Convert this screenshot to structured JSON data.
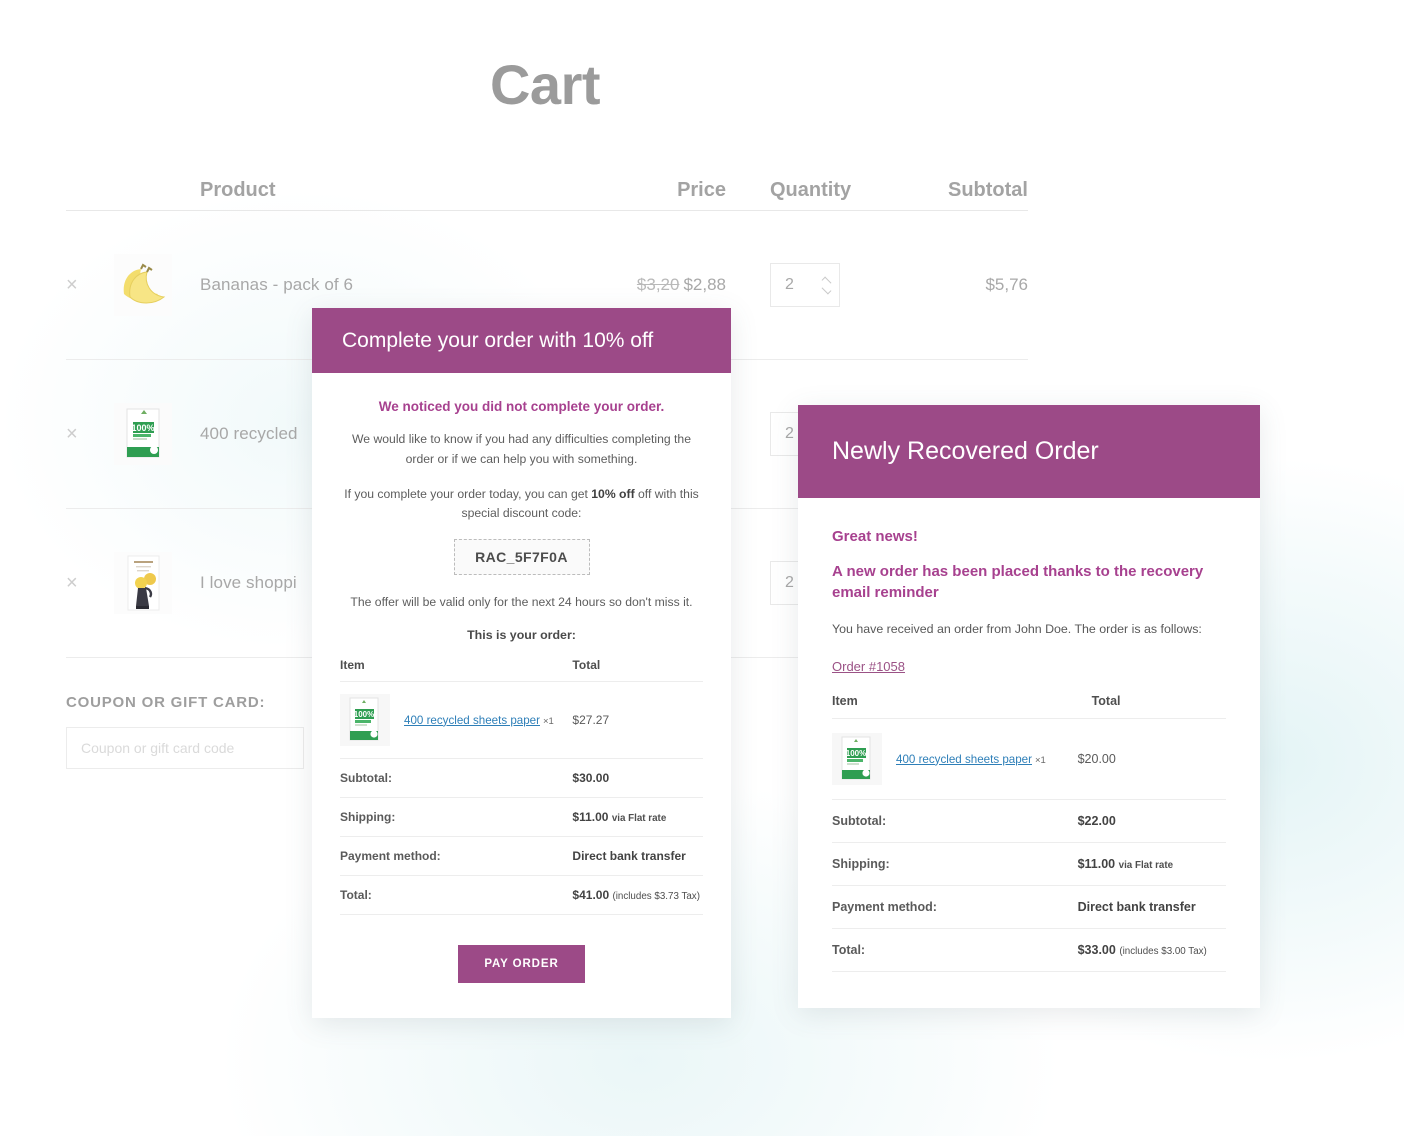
{
  "page": {
    "title": "Cart"
  },
  "cart": {
    "columns": {
      "product": "Product",
      "price": "Price",
      "quantity": "Quantity",
      "subtotal": "Subtotal"
    },
    "remove_symbol": "×",
    "rows": [
      {
        "name": "Bananas - pack of 6",
        "price_old": "$3,20",
        "price_new": "$2,88",
        "quantity": "2",
        "subtotal": "$5,76",
        "thumb": "bananas-thumbnail"
      },
      {
        "name": "400 recycled",
        "price_old": "",
        "price_new": "",
        "quantity": "2",
        "subtotal": "",
        "thumb": "recycled-paper-thumbnail"
      },
      {
        "name": "I love shoppi",
        "price_old": "",
        "price_new": "",
        "quantity": "2",
        "subtotal": "",
        "thumb": "book-thumbnail"
      }
    ],
    "coupon": {
      "label": "COUPON OR GIFT CARD:",
      "placeholder": "Coupon or gift card code",
      "value": ""
    }
  },
  "email_popup": {
    "header": "Complete your order with 10% off",
    "heading": "We noticed you did not complete your order.",
    "paragraph1": "We would like to know if you had any difficulties completing the order or if we can help you with something.",
    "paragraph2_pre": "If you complete your order today, you can get ",
    "paragraph2_bold": "10% off",
    "paragraph2_post": " off with this special discount code:",
    "coupon_code": "RAC_5F7F0A",
    "validity": "The offer will be valid only for the next 24 hours so don't miss it.",
    "order_intro": "This is your order:",
    "table": {
      "col_item": "Item",
      "col_total": "Total",
      "items": [
        {
          "name": "400 recycled sheets paper",
          "qty": "×1",
          "total": "$27.27",
          "thumb": "recycled-paper-thumbnail"
        }
      ],
      "summary": [
        {
          "label": "Subtotal:",
          "value": "$30.00",
          "note": ""
        },
        {
          "label": "Shipping:",
          "value": "$11.00",
          "note": "via Flat rate"
        },
        {
          "label": "Payment method:",
          "value": "Direct bank transfer",
          "note": ""
        },
        {
          "label": "Total:",
          "value": "$41.00",
          "note": "(includes $3.73 Tax)"
        }
      ]
    },
    "pay_button": "PAY ORDER"
  },
  "recovered_popup": {
    "header": "Newly Recovered Order",
    "heading1": "Great news!",
    "heading2": "A new order has been placed thanks to the recovery email reminder",
    "paragraph": "You have received an order from John Doe. The order is as follows:",
    "order_link": "Order #1058",
    "table": {
      "col_item": "Item",
      "col_total": "Total",
      "items": [
        {
          "name": "400 recycled sheets paper",
          "qty": "×1",
          "total": "$20.00",
          "thumb": "recycled-paper-thumbnail"
        }
      ],
      "summary": [
        {
          "label": "Subtotal:",
          "value": "$22.00",
          "note": ""
        },
        {
          "label": "Shipping:",
          "value": "$11.00",
          "note": "via Flat rate"
        },
        {
          "label": "Payment method:",
          "value": "Direct bank transfer",
          "note": ""
        },
        {
          "label": "Total:",
          "value": "$33.00",
          "note": "(includes $3.00 Tax)"
        }
      ]
    }
  },
  "colors": {
    "brand_purple": "#9c4a87",
    "heading_purple": "#a7418f",
    "link_blue": "#2e7fb8",
    "muted_grey": "#a8a8a8"
  }
}
